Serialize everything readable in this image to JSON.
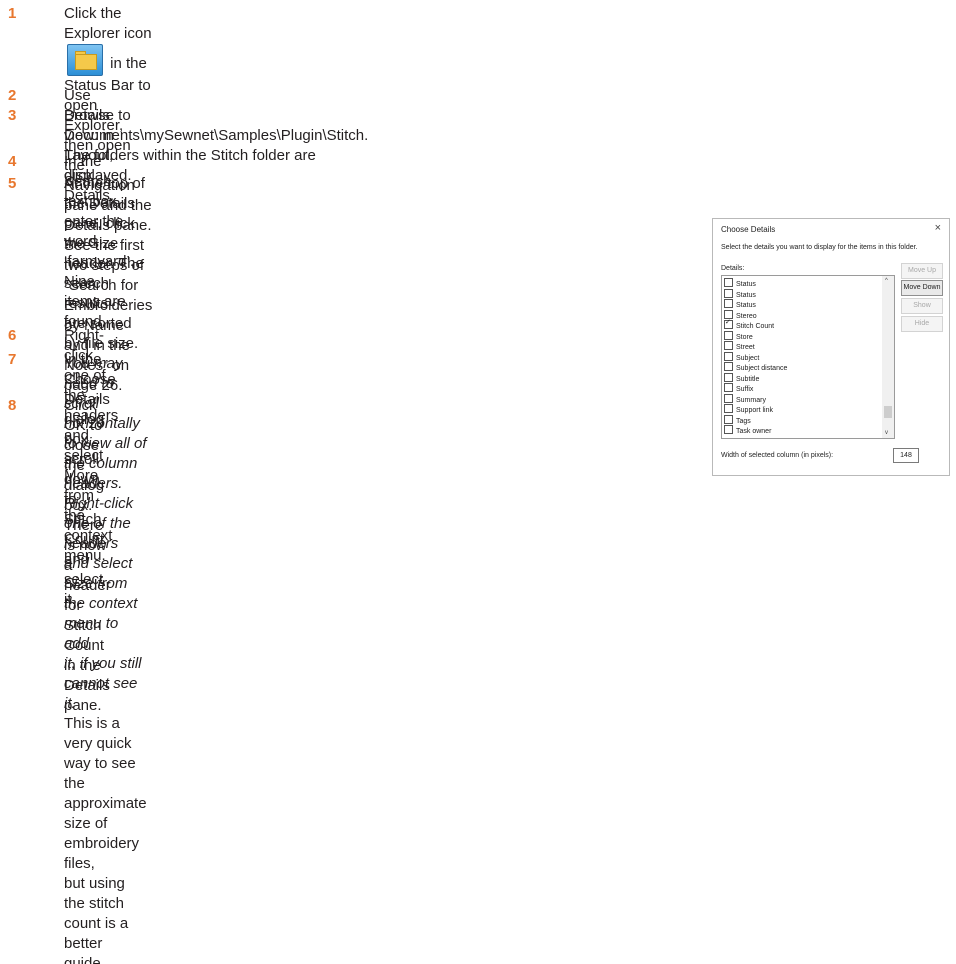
{
  "steps": [
    {
      "num": "1",
      "before_icon": "Click the Explorer icon",
      "after_icon": " in the Status Bar to open Explorer, then open the Navigation pane and the",
      "line2": "Details pane. See the first two steps of “Search for Embroideries by Name and in the Notes” on",
      "line3": "page 26."
    },
    {
      "num": "2",
      "text": "Use Details view: in Layout, click Details."
    },
    {
      "num": "3",
      "line1": "Browse to Documents\\mySewnet\\Samples\\Plugin\\Stitch. The folders within the Stitch folder are",
      "line2": "displayed."
    },
    {
      "num": "4",
      "text": "In the Search text box, enter the word ‘farmyard’. Nine items are found."
    },
    {
      "num": "5",
      "line1": "At the top of the Details pane, click the Size header. The search results",
      "line2": "are sorted by file size.",
      "italic1": "You may need to scroll horizontally to view all of the column headers.",
      "italic2": "Right-click one of the headers and select Size from the context menu to add",
      "italic3": "it, if you still cannot see it.",
      "plain1": "This is a very quick way to see the approximate size of embroidery files,",
      "plain2": "but using the stitch count is a better guide."
    },
    {
      "num": "6",
      "text": "Right-click one of the headers and select More from the context menu."
    },
    {
      "num": "7",
      "line1": "In the Choose Details dialog box, scroll down to Stitch Count and select",
      "line2": "it."
    },
    {
      "num": "8",
      "line1": "Click OK to close the dialog box. There is now a header for Stitch Count",
      "line2": "in the Details pane."
    }
  ],
  "icon": "explorer-icon",
  "dialog": {
    "title": "Choose Details",
    "close": "×",
    "instructions": "Select the details you want to display for the items in this folder.",
    "details_label": "Details:",
    "items": [
      {
        "label": "Status",
        "checked": false
      },
      {
        "label": "Status",
        "checked": false
      },
      {
        "label": "Status",
        "checked": false
      },
      {
        "label": "Stereo",
        "checked": false
      },
      {
        "label": "Stitch Count",
        "checked": true
      },
      {
        "label": "Store",
        "checked": false
      },
      {
        "label": "Street",
        "checked": false
      },
      {
        "label": "Subject",
        "checked": false
      },
      {
        "label": "Subject distance",
        "checked": false
      },
      {
        "label": "Subtitle",
        "checked": false
      },
      {
        "label": "Suffix",
        "checked": false
      },
      {
        "label": "Summary",
        "checked": false
      },
      {
        "label": "Support link",
        "checked": false
      },
      {
        "label": "Tags",
        "checked": false
      },
      {
        "label": "Task owner",
        "checked": false
      }
    ],
    "buttons": {
      "move_up": "Move Up",
      "move_down": "Move Down",
      "show": "Show",
      "hide": "Hide"
    },
    "width_label": "Width of selected column (in pixels):",
    "width_value": "148",
    "scroll_up": "^",
    "scroll_down": "v"
  }
}
